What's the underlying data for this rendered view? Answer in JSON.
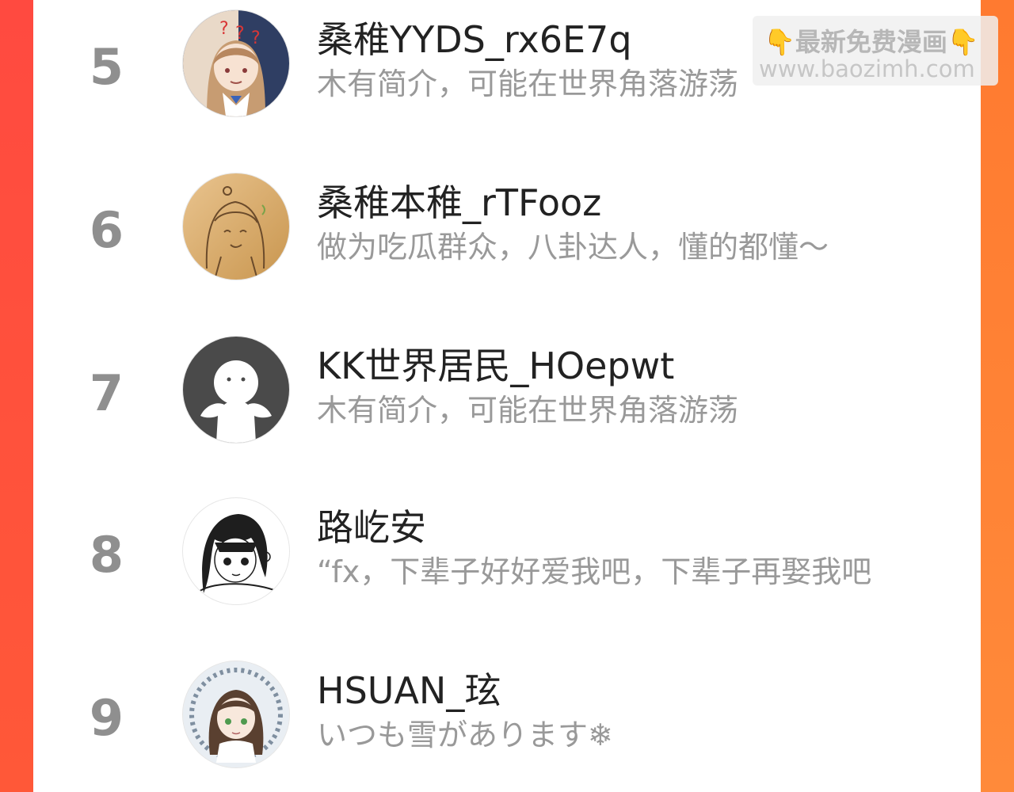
{
  "watermark": {
    "line1": "最新免费漫画",
    "line2": "www.baozimh.com"
  },
  "users": [
    {
      "rank": "5",
      "name": "桑稚YYDS_rx6E7q",
      "bio": "木有简介，可能在世界角落游荡",
      "avatar": "avatar-girl-brown-hair-icon"
    },
    {
      "rank": "6",
      "name": "桑稚本稚_rTFooz",
      "bio": "做为吃瓜群众，八卦达人，懂的都懂～",
      "avatar": "avatar-sketch-girl-icon"
    },
    {
      "rank": "7",
      "name": "KK世界居民_HOepwt",
      "bio": "木有简介，可能在世界角落游荡",
      "avatar": "avatar-default-person-icon"
    },
    {
      "rank": "8",
      "name": "路屹安",
      "bio": "“fx，下辈子好好爱我吧，下辈子再娶我吧",
      "avatar": "avatar-manga-girl-icon"
    },
    {
      "rank": "9",
      "name": "HSUAN_玹",
      "bio": "いつも雪があります❄",
      "avatar": "avatar-girl-wreath-icon"
    }
  ],
  "colors": {
    "accent_left": "#ff4d3d",
    "accent_right": "#ff7a30",
    "rank_text": "#8f8f8f",
    "bio_text": "#999999"
  }
}
